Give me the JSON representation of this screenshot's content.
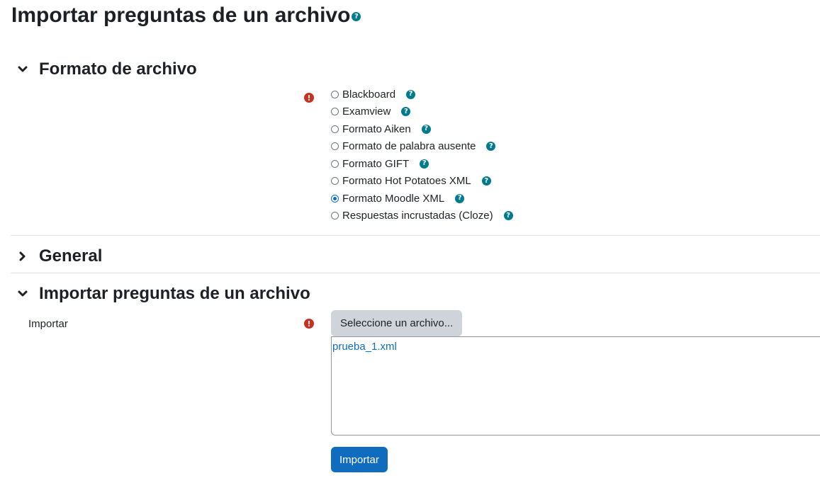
{
  "page": {
    "title": "Importar preguntas de un archivo"
  },
  "sections": {
    "format": {
      "title": "Formato de archivo",
      "options": [
        {
          "label": "Blackboard",
          "checked": false
        },
        {
          "label": "Examview",
          "checked": false
        },
        {
          "label": "Formato Aiken",
          "checked": false
        },
        {
          "label": "Formato de palabra ausente",
          "checked": false
        },
        {
          "label": "Formato GIFT",
          "checked": false
        },
        {
          "label": "Formato Hot Potatoes XML",
          "checked": false
        },
        {
          "label": "Formato Moodle XML",
          "checked": true
        },
        {
          "label": "Respuestas incrustadas (Cloze)",
          "checked": false
        }
      ]
    },
    "general": {
      "title": "General"
    },
    "import": {
      "title": "Importar preguntas de un archivo",
      "field_label": "Importar",
      "select_button": "Seleccione un archivo...",
      "file_name": "prueba_1.xml",
      "submit_button": "Importar"
    }
  },
  "icons": {
    "help": "question-circle-icon",
    "required": "exclamation-circle-icon",
    "expanded": "chevron-down-icon",
    "collapsed": "chevron-right-icon"
  },
  "colors": {
    "primary": "#0f6cbf",
    "help": "#007a8e",
    "required": "#ca3120",
    "secondary_button": "#ced4da"
  }
}
